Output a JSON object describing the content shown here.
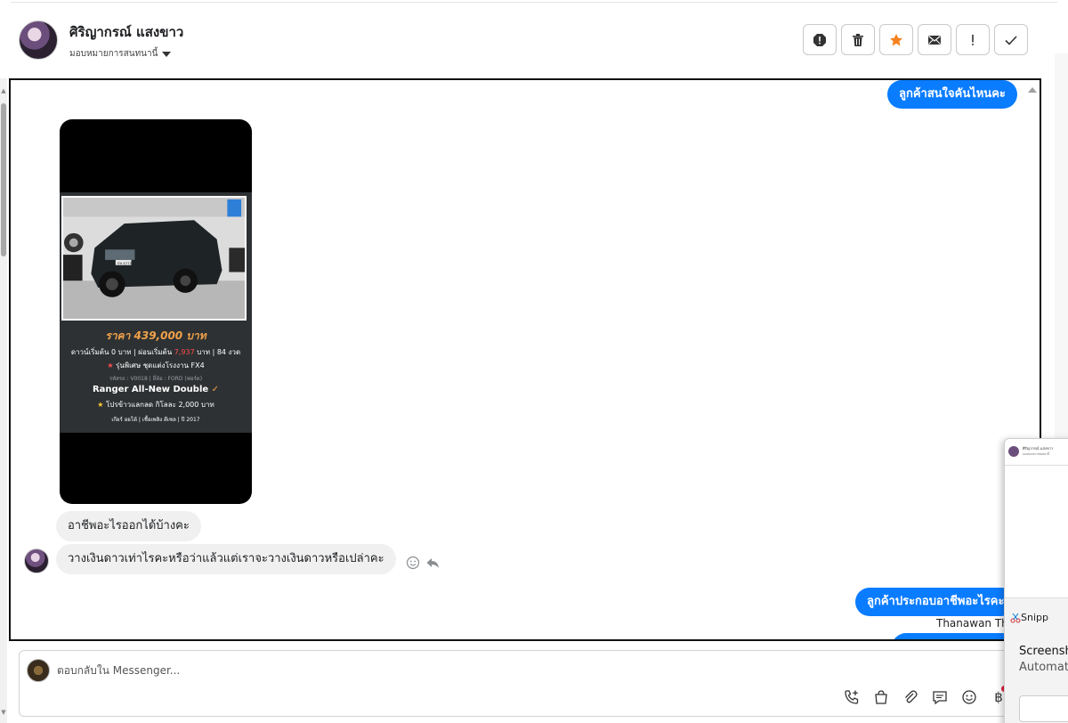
{
  "header": {
    "contact_name": "ศิริญากรณ์ แสงขาว",
    "assign_label": "มอบหมายการสนทนานี้",
    "toolbar": [
      {
        "name": "spam-alert-icon"
      },
      {
        "name": "trash-icon"
      },
      {
        "name": "star-icon",
        "color": "#f5821f"
      },
      {
        "name": "envelope-icon"
      },
      {
        "name": "exclamation-icon"
      },
      {
        "name": "check-icon"
      }
    ]
  },
  "messages": {
    "out_1": "ลูกค้าสนใจคันไหนคะ",
    "card": {
      "price": "ราคา 439,000 บาท",
      "line1_prefix": "ดาวน์เริ่มต้น 0 บาท | ผ่อนเริ่มต้น",
      "line1_installment": "7,937",
      "line1_suffix": "บาท | 84 งวด",
      "line2": "รุ่นพิเศษ ชุดแต่งโรงงาน FX4",
      "line3": "รหัสรถ : V0018 | ยี่ห้อ : FORD (ฟอร์ด)",
      "model": "Ranger All-New Double",
      "promo": "โปรข้าวแลกลด กิโลละ 2,000 บาท",
      "specs": "เกียร์ ออโต้  |  เชื้อเพลิง ดีเซล  |  ปี 2017",
      "plate": "ภษ 4771"
    },
    "in_1": "อาชีพอะไรออกได้บ้างคะ",
    "in_2": "วางเงินดาวเท่าไรคะหรือว่าแล้วแต่เราจะวางเงินดาวหรือเปล่าคะ",
    "out_2": "ลูกค้าประกอบอาชีพอะไรคะ",
    "out_2_sender": "Thanawan Tho"
  },
  "composer": {
    "placeholder": "ตอบกลับใน Messenger...",
    "tools": [
      "phone-add-icon",
      "shopping-bag-icon",
      "paperclip-icon",
      "quick-reply-icon",
      "emoji-icon",
      "baht-icon"
    ]
  },
  "snipping_tool": {
    "mini_title": "ศิริญากรณ์ แสงขาว",
    "mini_subtitle": "มอบหมายการสนทนานี้",
    "app_name": "Snipp",
    "title": "Screensh",
    "description": "Automat"
  }
}
